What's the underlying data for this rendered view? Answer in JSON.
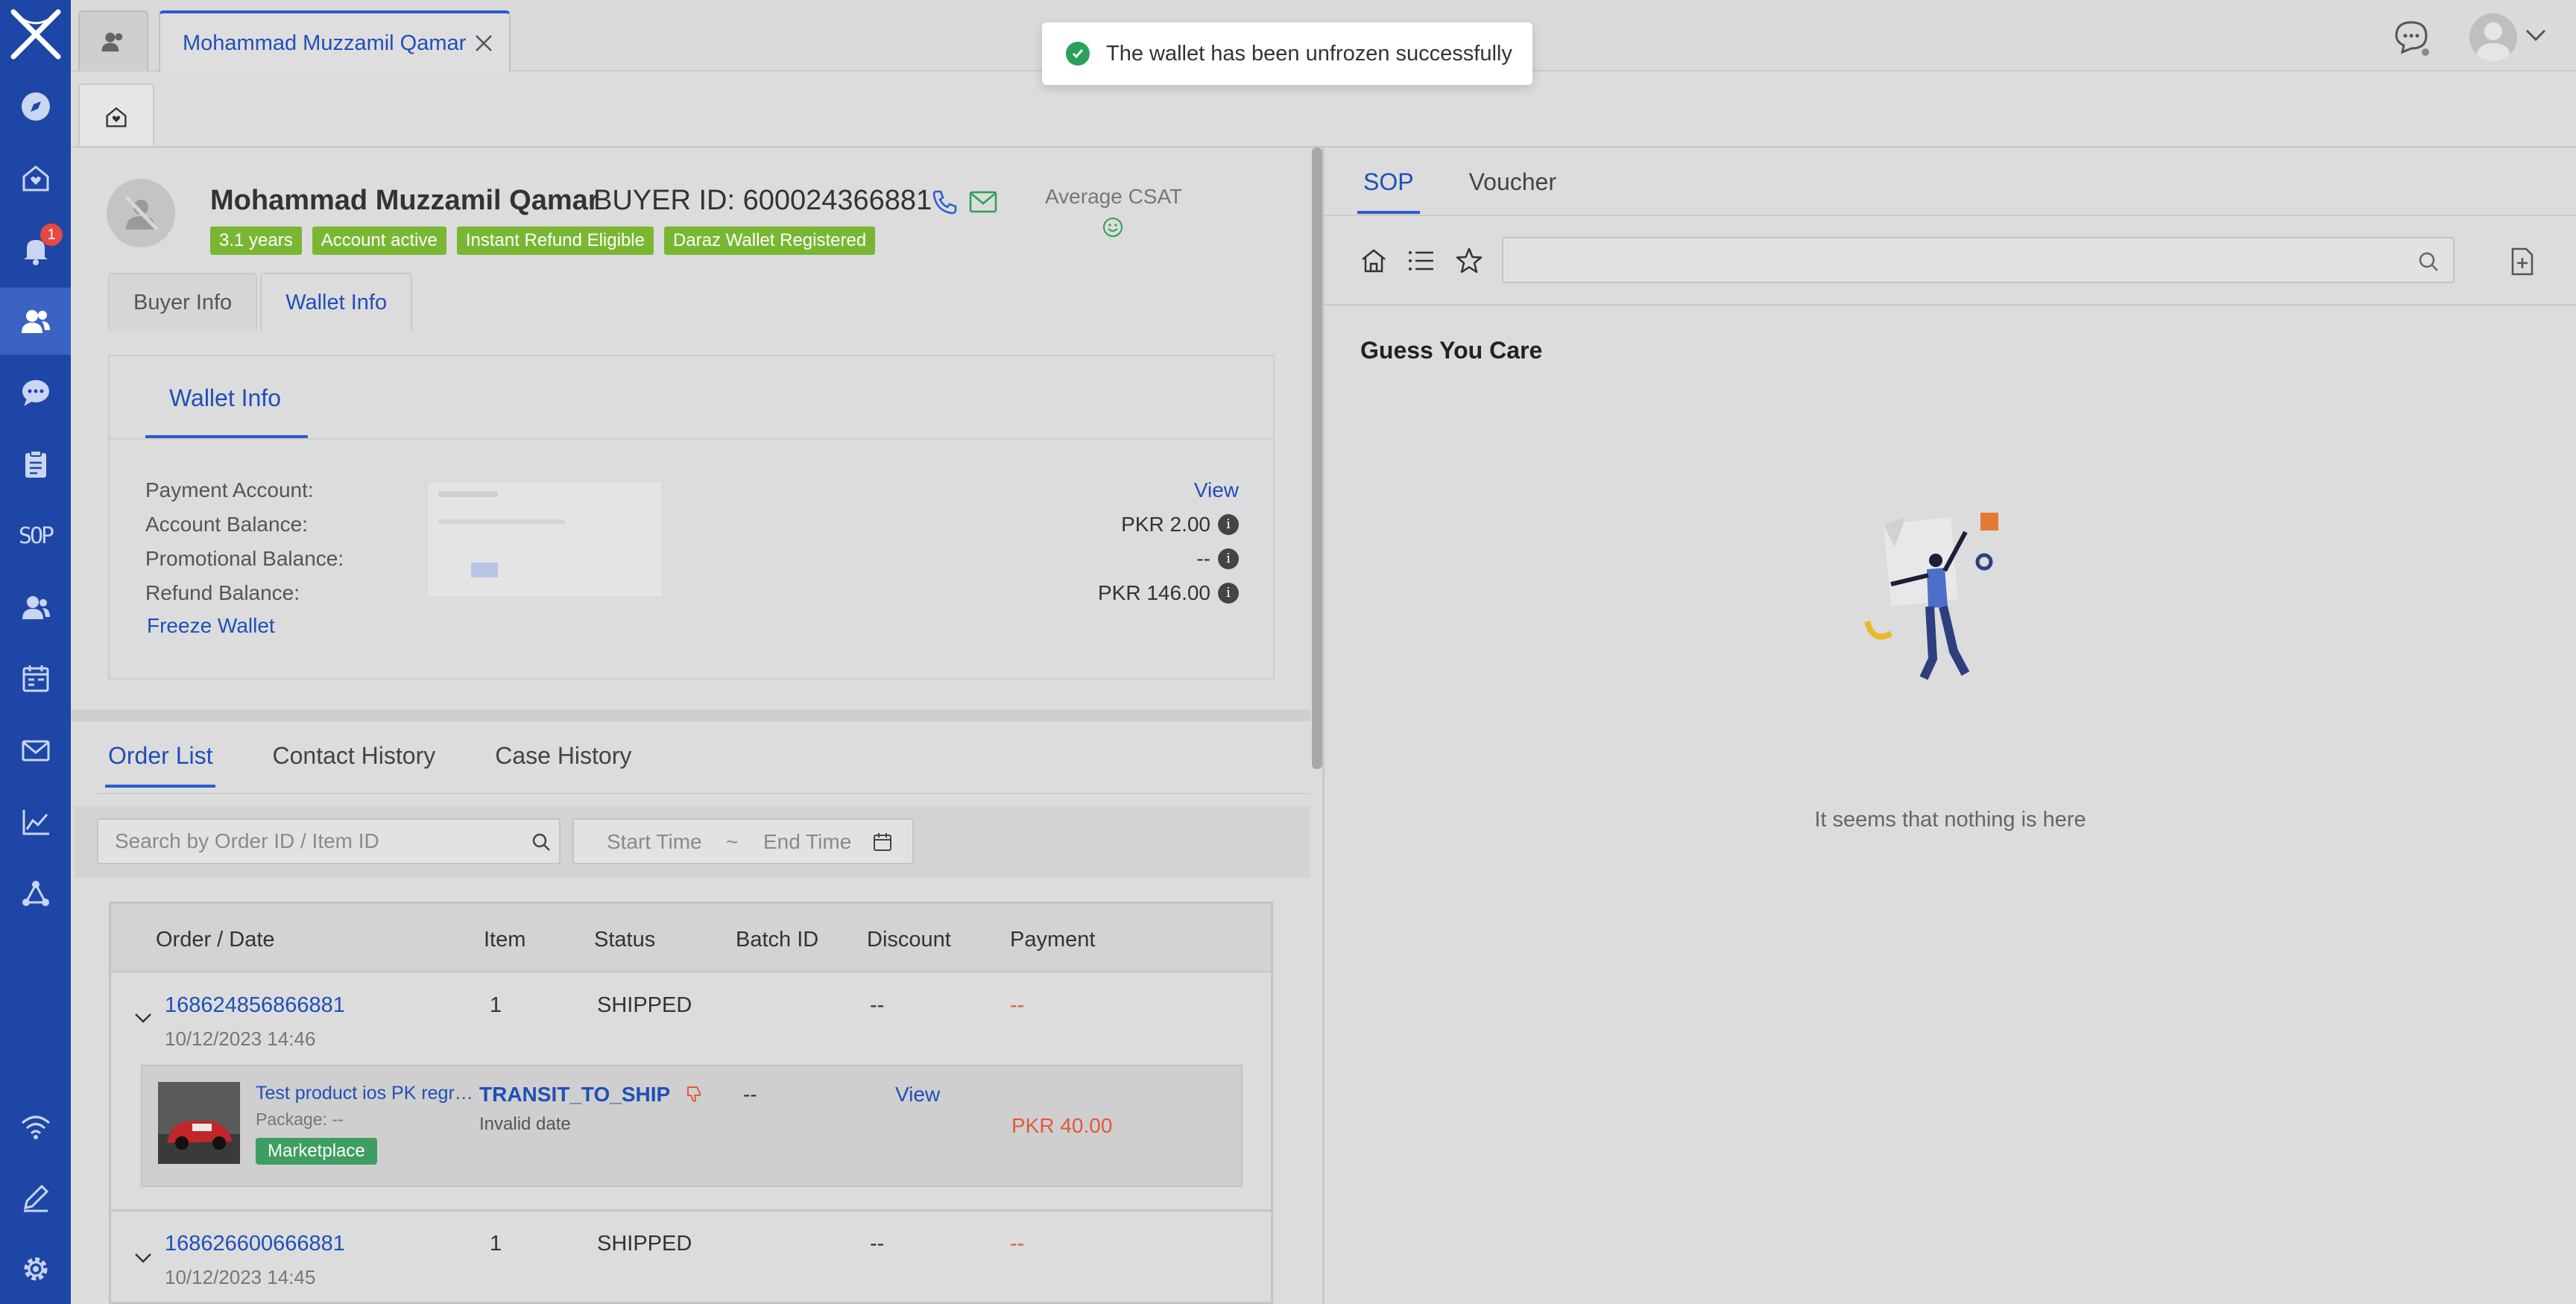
{
  "tabs": {
    "customer_tab_label": "Mohammad Muzzamil Qamar"
  },
  "toast": {
    "message": "The wallet has been unfrozen successfully"
  },
  "sidebar": {
    "notification_count": "1",
    "sop_label": "SOP",
    "items": [
      "compass-icon",
      "home-heart-icon",
      "bell-icon",
      "users-icon",
      "chat-icon",
      "clipboard-icon",
      "sop-icon",
      "person-icon",
      "calendar-icon",
      "mail-icon",
      "chart-icon",
      "network-icon",
      "wifi-icon",
      "pencil-icon",
      "gear-icon"
    ]
  },
  "profile": {
    "name": "Mohammad Muzzamil Qamar",
    "buyer_id": "BUYER ID: 600024366881",
    "csat_label": "Average CSAT",
    "tags": [
      "3.1 years",
      "Account active",
      "Instant Refund Eligible",
      "Daraz Wallet Registered"
    ],
    "tag_color": "#79b733"
  },
  "info_tabs": {
    "buyer_info": "Buyer Info",
    "wallet_info": "Wallet Info"
  },
  "wallet": {
    "title": "Wallet Info",
    "payment_account_label": "Payment Account:",
    "payment_account_value": "View",
    "account_balance_label": "Account Balance:",
    "account_balance_value": "PKR 2.00",
    "promotional_balance_label": "Promotional Balance:",
    "promotional_balance_value": "--",
    "refund_balance_label": "Refund Balance:",
    "refund_balance_value": "PKR 146.00",
    "freeze_link": "Freeze Wallet"
  },
  "order_section": {
    "tabs": [
      "Order List",
      "Contact History",
      "Case History"
    ],
    "search_placeholder": "Search by Order ID / Item ID",
    "start_time": "Start Time",
    "range_sep": "~",
    "end_time": "End Time",
    "columns": [
      "Order / Date",
      "Item",
      "Status",
      "Batch ID",
      "Discount",
      "Payment"
    ],
    "orders": [
      {
        "id": "168624856866881",
        "date": "10/12/2023 14:46",
        "items": "1",
        "status": "SHIPPED",
        "discount": "--",
        "payment": "--",
        "line_item": {
          "title": "Test product ios PK regression",
          "package": "Package: --",
          "tag": "Marketplace",
          "status": "TRANSIT_TO_SHIP",
          "date": "Invalid date",
          "batch": "--",
          "action": "View",
          "price": "PKR 40.00"
        }
      },
      {
        "id": "168626600666881",
        "date": "10/12/2023 14:45",
        "items": "1",
        "status": "SHIPPED",
        "discount": "--",
        "payment": "--"
      }
    ]
  },
  "right": {
    "tabs": [
      "SOP",
      "Voucher"
    ],
    "guess_title": "Guess You Care",
    "empty_text": "It seems that nothing is here"
  },
  "colors": {
    "sidebar": "#1e46a6",
    "accent": "#2a5bd0",
    "link": "#1f4fb8",
    "danger": "#e05a3c",
    "success": "#2aa05a"
  }
}
